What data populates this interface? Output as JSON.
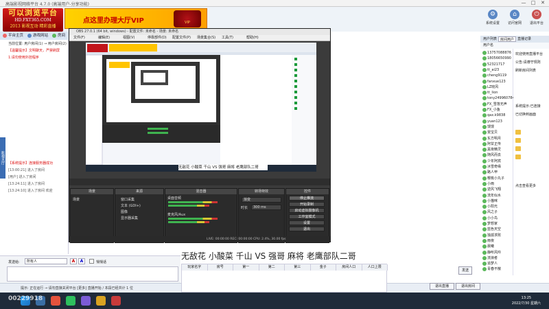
{
  "app": {
    "title": "高端影视网络平台 4.7.0 (高端用户-分享功能)",
    "window_controls": [
      "—",
      "□",
      "✕"
    ]
  },
  "logo": {
    "line1": "可以浏览平台",
    "line2": "HD.FXT365.COM",
    "line3": "2013 影视互动 精彩直播"
  },
  "vip_banner": {
    "text": "点这里办理大厅VIP",
    "badge": "VIP"
  },
  "toolbar": [
    {
      "label": "系统设置",
      "icon": "gear-icon"
    },
    {
      "label": "访问官网",
      "icon": "home-icon"
    },
    {
      "label": "退出平台",
      "icon": "exit-icon"
    }
  ],
  "nav": {
    "home": "平台主页",
    "apps": "游戏网站",
    "nav3": "房间"
  },
  "left_vtab": "影视大厅",
  "chat": {
    "lines": [
      {
        "text": "当前位置: 用户房间(1) → 用户房间(2)",
        "color": "#333"
      },
      {
        "text": "【温馨提示】文明聊天，严禁刷屏",
        "color": "#d11"
      },
      {
        "text": "1.请勿使用外挂程序",
        "color": "#d11"
      },
      {
        "text": "【系统提示】连接服务器成功",
        "color": "#d11"
      },
      {
        "text": "[13:00:21] 进入了房间",
        "color": "#555"
      },
      {
        "text": "[用户] 进入了房间",
        "color": "#555"
      },
      {
        "text": "[13:24:11] 进入了房间",
        "color": "#555"
      },
      {
        "text": "[13:24:10] 进入了房间 欢迎",
        "color": "#555"
      }
    ]
  },
  "input_bar": {
    "label": "发送给:",
    "target": "所有人",
    "checkbox_label": "悄悄话"
  },
  "status_bar": {
    "text": "提示: 正在运行 → 请勿直接关闭平台 [更多] 直播开始 / 本段已经共计 1 位"
  },
  "right_panel": {
    "tabs": [
      "用户列表",
      "房间用户",
      "直播记录"
    ],
    "sub_header": "用户名",
    "users": [
      "13757088876",
      "18056650990",
      "52321717",
      "tt_ai23",
      "cheng9119",
      "fanxue123",
      "LZ晓风",
      "tt_lion",
      "tony249960784",
      "FX_雪落无声",
      "FX_小鱼",
      "qax.k9838",
      "yuan123",
      "馒馒",
      "雯宝贝",
      "东方明月",
      "阿甘正传",
      "黑夜精灵",
      "随风而去",
      "少年阿宾",
      "冰雪奇缘",
      "路人甲",
      "樱桃小丸子",
      "小雨",
      "逆风飞翔",
      "流年似水",
      "小猫咪",
      "小阳光",
      "风之子",
      "小小鸟",
      "梦想家",
      "蓝色天空",
      "独孤求败",
      "雨夜",
      "晨曦",
      "静听风吟",
      "流浪者",
      "追梦人",
      "青春不散"
    ],
    "system_notes": [
      "欢迎使用直播平台",
      "公告:请遵守规则",
      "刷新房间列表",
      "系统提示:已连接",
      "已切换到画面",
      "点击查看更多"
    ]
  },
  "buttons": {
    "send": "发送",
    "bottom1": "退出直播",
    "bottom2": "退出房间"
  },
  "scrolltext": "无敌花 小酸菜 千山 VS 强哥 麻将 老鹰部队二哥",
  "table": {
    "headers": [
      "玩家名字",
      "房号",
      "第一",
      "第二",
      "第三",
      "金子",
      "房间人口",
      "人口上限"
    ]
  },
  "obs": {
    "title": "OBS 27.0.1 (64 bit, windows) - 配置文件: 未命名 - 场景: 未命名",
    "menu": [
      "文件(F)",
      "编辑(E)",
      "视图(V)",
      "停靠部件(D)",
      "配置文件(P)",
      "场景集合(S)",
      "工具(T)",
      "帮助(H)"
    ],
    "caption": "无敌花 小酸菜 千山 VS 强哥 麻将 老鹰部队二哥",
    "docks": {
      "scenes": "场景",
      "sources": "来源",
      "mixer": "混音器",
      "transitions": "转场特效",
      "controls": "控件"
    },
    "scene_items": [
      "场景"
    ],
    "source_items": [
      "窗口采集",
      "文本 (GDI+)",
      "图像",
      "显示器采集"
    ],
    "mixer_items": [
      "桌面音频",
      "麦克风/Aux"
    ],
    "transition": {
      "type": "渐变",
      "duration_label": "时长",
      "duration": "300 ms"
    },
    "control_buttons": [
      "停止推流",
      "开始录制",
      "启动虚拟摄像机",
      "工作室模式",
      "设置",
      "退出"
    ],
    "status": "LIVE: 00:00:00   REC: 00:00:00   CPU: 2.4%, 30.00 fps"
  },
  "taskbar": {
    "watermark": "00229918",
    "time": "13:25",
    "date": "2022/7/30 星期六"
  }
}
